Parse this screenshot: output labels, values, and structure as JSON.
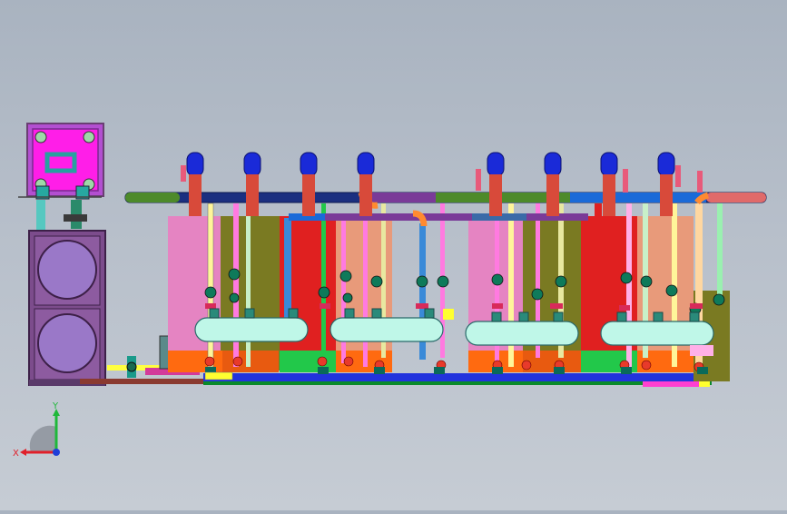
{
  "viewer": {
    "background_top": "#a9b3c0",
    "background_bottom": "#c6ccd4",
    "model": "pump-station-assembly"
  },
  "triad": {
    "x_label": "X",
    "y_label": "Y",
    "x_color": "#e0202a",
    "y_color": "#1fb83a",
    "z_color": "#1f3fd8"
  },
  "colors": {
    "tank_frame": "#6a3e73",
    "tank_fill": "#9a78c8",
    "tank_magenta": "#ff00ff",
    "header_navy": "#1b2f80",
    "header_green": "#4d8a2a",
    "header_purple": "#7a3a98",
    "motor_blue": "#1a2ad8",
    "vessel_cyan": "#bff7e8",
    "base_blue": "#2233dd",
    "base_green": "#22c84a",
    "pink": "#e584c2",
    "olive": "#7a7a22",
    "red": "#e02020",
    "salmon": "#e89a7a",
    "orange": "#ff6a10"
  }
}
